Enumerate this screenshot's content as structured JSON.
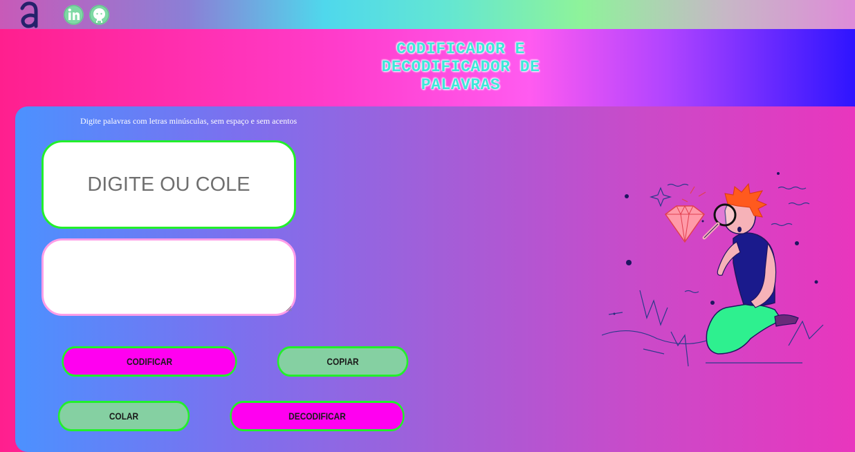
{
  "header": {
    "logo_icon": "alura-a-logo-icon",
    "social": [
      {
        "icon": "linkedin-icon",
        "label": "in"
      },
      {
        "icon": "github-icon"
      }
    ]
  },
  "title": {
    "line1": "CODIFICADOR E",
    "line2": "DECODIFICADOR DE",
    "line3": "PALAVRAS"
  },
  "main": {
    "hint": "Digite palavras com letras minúsculas, sem espaço e sem acentos",
    "input": {
      "placeholder": "DIGITE OU COLE",
      "value": ""
    },
    "output": {
      "value": ""
    }
  },
  "buttons": {
    "encode": "CODIFICAR",
    "copy": "COPIAR",
    "paste": "COLAR",
    "decode": "DECODIFICAR"
  },
  "colors": {
    "accent_green": "#22f02a",
    "magenta_button": "#ff00f0",
    "mint_button": "#85d0a2",
    "title_color": "#3fe7d9"
  },
  "illustration": {
    "icon": "person-with-magnifier-and-diamond-illustration"
  }
}
